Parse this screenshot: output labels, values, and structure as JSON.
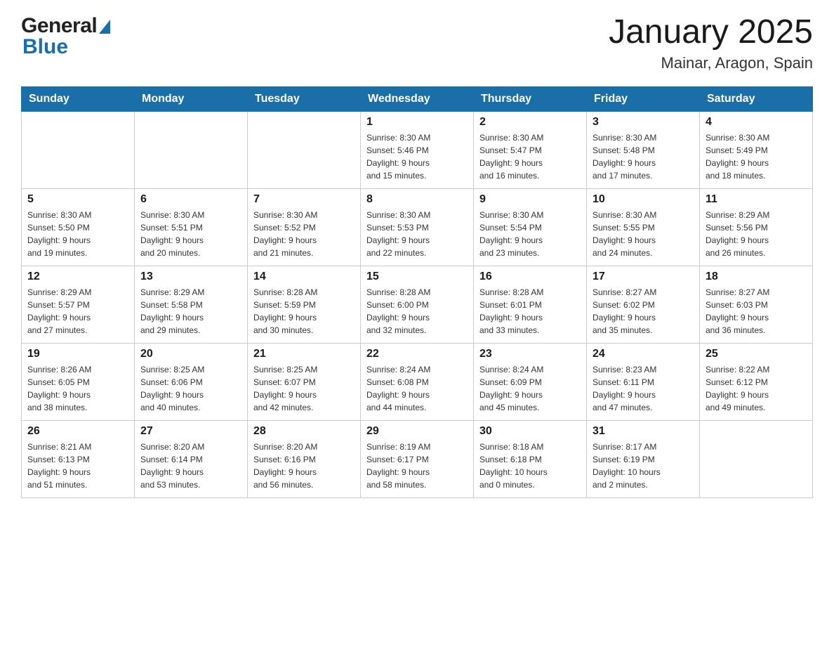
{
  "header": {
    "title": "January 2025",
    "subtitle": "Mainar, Aragon, Spain",
    "logo_general": "General",
    "logo_blue": "Blue"
  },
  "days_of_week": [
    "Sunday",
    "Monday",
    "Tuesday",
    "Wednesday",
    "Thursday",
    "Friday",
    "Saturday"
  ],
  "weeks": [
    [
      {
        "day": "",
        "info": ""
      },
      {
        "day": "",
        "info": ""
      },
      {
        "day": "",
        "info": ""
      },
      {
        "day": "1",
        "info": "Sunrise: 8:30 AM\nSunset: 5:46 PM\nDaylight: 9 hours\nand 15 minutes."
      },
      {
        "day": "2",
        "info": "Sunrise: 8:30 AM\nSunset: 5:47 PM\nDaylight: 9 hours\nand 16 minutes."
      },
      {
        "day": "3",
        "info": "Sunrise: 8:30 AM\nSunset: 5:48 PM\nDaylight: 9 hours\nand 17 minutes."
      },
      {
        "day": "4",
        "info": "Sunrise: 8:30 AM\nSunset: 5:49 PM\nDaylight: 9 hours\nand 18 minutes."
      }
    ],
    [
      {
        "day": "5",
        "info": "Sunrise: 8:30 AM\nSunset: 5:50 PM\nDaylight: 9 hours\nand 19 minutes."
      },
      {
        "day": "6",
        "info": "Sunrise: 8:30 AM\nSunset: 5:51 PM\nDaylight: 9 hours\nand 20 minutes."
      },
      {
        "day": "7",
        "info": "Sunrise: 8:30 AM\nSunset: 5:52 PM\nDaylight: 9 hours\nand 21 minutes."
      },
      {
        "day": "8",
        "info": "Sunrise: 8:30 AM\nSunset: 5:53 PM\nDaylight: 9 hours\nand 22 minutes."
      },
      {
        "day": "9",
        "info": "Sunrise: 8:30 AM\nSunset: 5:54 PM\nDaylight: 9 hours\nand 23 minutes."
      },
      {
        "day": "10",
        "info": "Sunrise: 8:30 AM\nSunset: 5:55 PM\nDaylight: 9 hours\nand 24 minutes."
      },
      {
        "day": "11",
        "info": "Sunrise: 8:29 AM\nSunset: 5:56 PM\nDaylight: 9 hours\nand 26 minutes."
      }
    ],
    [
      {
        "day": "12",
        "info": "Sunrise: 8:29 AM\nSunset: 5:57 PM\nDaylight: 9 hours\nand 27 minutes."
      },
      {
        "day": "13",
        "info": "Sunrise: 8:29 AM\nSunset: 5:58 PM\nDaylight: 9 hours\nand 29 minutes."
      },
      {
        "day": "14",
        "info": "Sunrise: 8:28 AM\nSunset: 5:59 PM\nDaylight: 9 hours\nand 30 minutes."
      },
      {
        "day": "15",
        "info": "Sunrise: 8:28 AM\nSunset: 6:00 PM\nDaylight: 9 hours\nand 32 minutes."
      },
      {
        "day": "16",
        "info": "Sunrise: 8:28 AM\nSunset: 6:01 PM\nDaylight: 9 hours\nand 33 minutes."
      },
      {
        "day": "17",
        "info": "Sunrise: 8:27 AM\nSunset: 6:02 PM\nDaylight: 9 hours\nand 35 minutes."
      },
      {
        "day": "18",
        "info": "Sunrise: 8:27 AM\nSunset: 6:03 PM\nDaylight: 9 hours\nand 36 minutes."
      }
    ],
    [
      {
        "day": "19",
        "info": "Sunrise: 8:26 AM\nSunset: 6:05 PM\nDaylight: 9 hours\nand 38 minutes."
      },
      {
        "day": "20",
        "info": "Sunrise: 8:25 AM\nSunset: 6:06 PM\nDaylight: 9 hours\nand 40 minutes."
      },
      {
        "day": "21",
        "info": "Sunrise: 8:25 AM\nSunset: 6:07 PM\nDaylight: 9 hours\nand 42 minutes."
      },
      {
        "day": "22",
        "info": "Sunrise: 8:24 AM\nSunset: 6:08 PM\nDaylight: 9 hours\nand 44 minutes."
      },
      {
        "day": "23",
        "info": "Sunrise: 8:24 AM\nSunset: 6:09 PM\nDaylight: 9 hours\nand 45 minutes."
      },
      {
        "day": "24",
        "info": "Sunrise: 8:23 AM\nSunset: 6:11 PM\nDaylight: 9 hours\nand 47 minutes."
      },
      {
        "day": "25",
        "info": "Sunrise: 8:22 AM\nSunset: 6:12 PM\nDaylight: 9 hours\nand 49 minutes."
      }
    ],
    [
      {
        "day": "26",
        "info": "Sunrise: 8:21 AM\nSunset: 6:13 PM\nDaylight: 9 hours\nand 51 minutes."
      },
      {
        "day": "27",
        "info": "Sunrise: 8:20 AM\nSunset: 6:14 PM\nDaylight: 9 hours\nand 53 minutes."
      },
      {
        "day": "28",
        "info": "Sunrise: 8:20 AM\nSunset: 6:16 PM\nDaylight: 9 hours\nand 56 minutes."
      },
      {
        "day": "29",
        "info": "Sunrise: 8:19 AM\nSunset: 6:17 PM\nDaylight: 9 hours\nand 58 minutes."
      },
      {
        "day": "30",
        "info": "Sunrise: 8:18 AM\nSunset: 6:18 PM\nDaylight: 10 hours\nand 0 minutes."
      },
      {
        "day": "31",
        "info": "Sunrise: 8:17 AM\nSunset: 6:19 PM\nDaylight: 10 hours\nand 2 minutes."
      },
      {
        "day": "",
        "info": ""
      }
    ]
  ]
}
